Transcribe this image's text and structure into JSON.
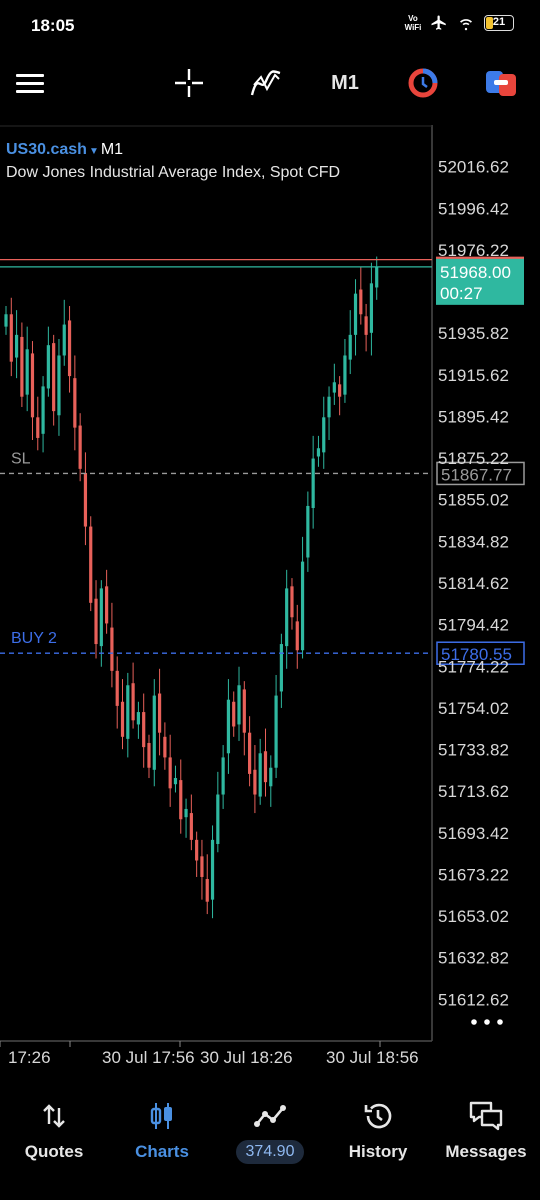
{
  "status_bar": {
    "time": "18:05",
    "network_label": "Vo WiFi",
    "battery_level": "21",
    "icons": [
      "airplane-icon",
      "wifi-icon",
      "battery-icon"
    ]
  },
  "toolbar": {
    "timeframe": "M1",
    "icons": [
      "menu-icon",
      "crosshair-icon",
      "indicators-icon",
      "timeframe-label",
      "one-click-trading-icon",
      "trade-icon"
    ]
  },
  "symbol": {
    "name": "US30.cash",
    "timeframe": "M1",
    "description": "Dow Jones Industrial Average Index, Spot CFD"
  },
  "chart_data": {
    "type": "candlestick",
    "y_tick_labels": [
      "52016.62",
      "51996.42",
      "51976.22",
      "51935.82",
      "51915.62",
      "51895.42",
      "51875.22",
      "51855.02",
      "51834.82",
      "51814.62",
      "51794.42",
      "51774.22",
      "51754.02",
      "51733.82",
      "51713.62",
      "51693.42",
      "51673.22",
      "51653.02",
      "51632.82",
      "51612.62"
    ],
    "y_ticks": [
      52016.62,
      51996.42,
      51976.22,
      51935.82,
      51915.62,
      51895.42,
      51875.22,
      51855.02,
      51834.82,
      51814.62,
      51794.42,
      51774.22,
      51754.02,
      51733.82,
      51713.62,
      51693.42,
      51673.22,
      51653.02,
      51632.82,
      51612.62
    ],
    "ylim": [
      51592.42,
      52036.82
    ],
    "x_tick_labels": [
      "17:26",
      "30 Jul 17:56",
      "30 Jul 18:26",
      "30 Jul 18:56"
    ],
    "current_price": "51968.00",
    "countdown": "00:27",
    "ask_line": 51971.5,
    "bid_line": 51968.0,
    "levels": [
      {
        "label": "SL",
        "price": 51867.77,
        "price_label": "51867.77",
        "color": "#9a9a9a"
      },
      {
        "label": "BUY 2",
        "price": 51780.55,
        "price_label": "51780.55",
        "color": "#3d6ee8"
      }
    ],
    "colors": {
      "up": "#2fb8a0",
      "down": "#e8615a",
      "ask": "#e8615a",
      "bid": "#2fb8a0"
    },
    "close_path": [
      51945,
      51922,
      51935,
      51905,
      51928,
      51895,
      51885,
      51910,
      51930,
      51898,
      51925,
      51940,
      51915,
      51890,
      51870,
      51842,
      51805,
      51785,
      51812,
      51795,
      51772,
      51755,
      51740,
      51765,
      51748,
      51752,
      51735,
      51725,
      51760,
      51742,
      51730,
      51715,
      51720,
      51700,
      51705,
      51690,
      51680,
      51672,
      51660,
      51690,
      51712,
      51730,
      51758,
      51745,
      51765,
      51742,
      51722,
      51712,
      51732,
      51718,
      51725,
      51760,
      51785,
      51812,
      51798,
      51782,
      51825,
      51852,
      51875,
      51880,
      51895,
      51905,
      51912,
      51905,
      51925,
      51935,
      51955,
      51945,
      51935,
      51960,
      51968
    ],
    "more_options_icon": "more-horizontal-icon"
  },
  "bottom_nav": {
    "items": [
      {
        "label": "Quotes",
        "icon": "quotes-arrows-icon"
      },
      {
        "label": "Charts",
        "icon": "candles-icon"
      },
      {
        "label": "374.90",
        "icon": "trade-line-icon"
      },
      {
        "label": "History",
        "icon": "history-clock-icon"
      },
      {
        "label": "Messages",
        "icon": "messages-icon"
      }
    ]
  }
}
